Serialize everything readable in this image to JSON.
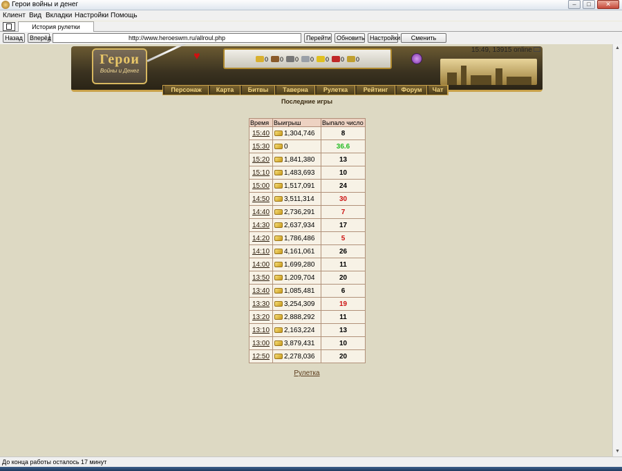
{
  "window": {
    "title": "Герои войны и денег",
    "min": "–",
    "max": "□",
    "close": "✕"
  },
  "menu": [
    "Клиент",
    "Вид",
    "Вкладки",
    "Настройки",
    "Помощь"
  ],
  "tabs": [
    {
      "label": "История рулетки"
    }
  ],
  "nav": {
    "back": "Назад",
    "forward": "Вперёд",
    "url": "http://www.heroeswm.ru/allroul.php",
    "go": "Перейти",
    "refresh": "Обновить",
    "settings": "Настройки",
    "switch_player": "Сменить игрока"
  },
  "header": {
    "logo_title": "Герои",
    "logo_subtitle": "Войны и Денег",
    "resources": [
      {
        "name": "gold",
        "value": "0",
        "color": "#d8b030"
      },
      {
        "name": "wood",
        "value": "0",
        "color": "#8a5a2a"
      },
      {
        "name": "ore",
        "value": "0",
        "color": "#777777"
      },
      {
        "name": "mercury",
        "value": "0",
        "color": "#9aa0a8"
      },
      {
        "name": "sulfur",
        "value": "0",
        "color": "#e0c020"
      },
      {
        "name": "crystals",
        "value": "0",
        "color": "#c02828"
      },
      {
        "name": "gems",
        "value": "0",
        "color": "#c0a030"
      }
    ],
    "online": "15:49, 13915 online"
  },
  "main_menu": [
    "Персонаж",
    "Карта",
    "Битвы",
    "Таверна",
    "Рулетка",
    "Рейтинг",
    "Форум",
    "Чат"
  ],
  "page_title": "Последние игры",
  "table": {
    "headers": [
      "Время",
      "Выигрыш",
      "Выпало число"
    ],
    "rows": [
      {
        "time": "15:40",
        "win": "1,304,746",
        "number": "8",
        "color": "#000000"
      },
      {
        "time": "15:30",
        "win": "0",
        "number": "36.6",
        "color": "#22bb22"
      },
      {
        "time": "15:20",
        "win": "1,841,380",
        "number": "13",
        "color": "#000000"
      },
      {
        "time": "15:10",
        "win": "1,483,693",
        "number": "10",
        "color": "#000000"
      },
      {
        "time": "15:00",
        "win": "1,517,091",
        "number": "24",
        "color": "#000000"
      },
      {
        "time": "14:50",
        "win": "3,511,314",
        "number": "30",
        "color": "#cc1111"
      },
      {
        "time": "14:40",
        "win": "2,736,291",
        "number": "7",
        "color": "#cc1111"
      },
      {
        "time": "14:30",
        "win": "2,637,934",
        "number": "17",
        "color": "#000000"
      },
      {
        "time": "14:20",
        "win": "1,786,486",
        "number": "5",
        "color": "#cc1111"
      },
      {
        "time": "14:10",
        "win": "4,161,061",
        "number": "26",
        "color": "#000000"
      },
      {
        "time": "14:00",
        "win": "1,699,280",
        "number": "11",
        "color": "#000000"
      },
      {
        "time": "13:50",
        "win": "1,209,704",
        "number": "20",
        "color": "#000000"
      },
      {
        "time": "13:40",
        "win": "1,085,481",
        "number": "6",
        "color": "#000000"
      },
      {
        "time": "13:30",
        "win": "3,254,309",
        "number": "19",
        "color": "#cc1111"
      },
      {
        "time": "13:20",
        "win": "2,888,292",
        "number": "11",
        "color": "#000000"
      },
      {
        "time": "13:10",
        "win": "2,163,224",
        "number": "13",
        "color": "#000000"
      },
      {
        "time": "13:00",
        "win": "3,879,431",
        "number": "10",
        "color": "#000000"
      },
      {
        "time": "12:50",
        "win": "2,278,036",
        "number": "20",
        "color": "#000000"
      }
    ]
  },
  "footer_link": "Рулетка",
  "status": "До конца работы осталось 17 минут"
}
